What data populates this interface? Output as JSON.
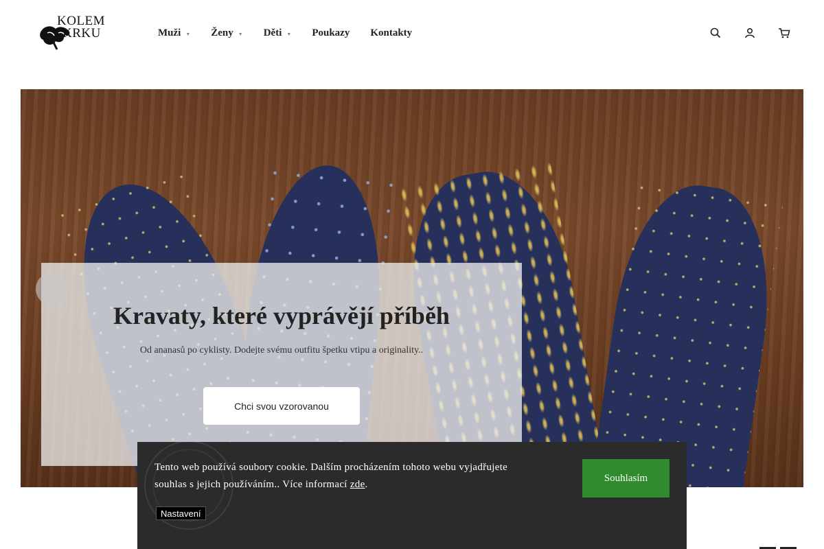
{
  "logo": {
    "line1": "KOLEM",
    "line2": "KRKU"
  },
  "nav": [
    {
      "label": "Muži",
      "has_dropdown": true
    },
    {
      "label": "Ženy",
      "has_dropdown": true
    },
    {
      "label": "Děti",
      "has_dropdown": true
    },
    {
      "label": "Poukazy",
      "has_dropdown": false
    },
    {
      "label": "Kontakty",
      "has_dropdown": false
    }
  ],
  "header_icons": [
    "search-icon",
    "user-icon",
    "cart-icon"
  ],
  "hero": {
    "title": "Kravaty, které vyprávějí příběh",
    "subtitle": "Od ananasů po cyklisty. Dodejte svému outfitu špetku vtipu a originality..",
    "button": "Chci svou vzorovanou",
    "arrow_glyph": "",
    "arrow_icon": "chevron-left-icon"
  },
  "cookie": {
    "text": "Tento web používá soubory cookie. Dalším procházením tohoto webu vyjadřujete souhlas s jejich používáním.. Více informací ",
    "link": "zde",
    "after_link": ".",
    "accept": "Souhlasím",
    "settings": "Nastavení"
  },
  "colors": {
    "accept_green": "#2e8b2e",
    "cookie_bg": "#2b2b2b",
    "tie_navy": "#27305a",
    "wood": "#6b3e22"
  }
}
